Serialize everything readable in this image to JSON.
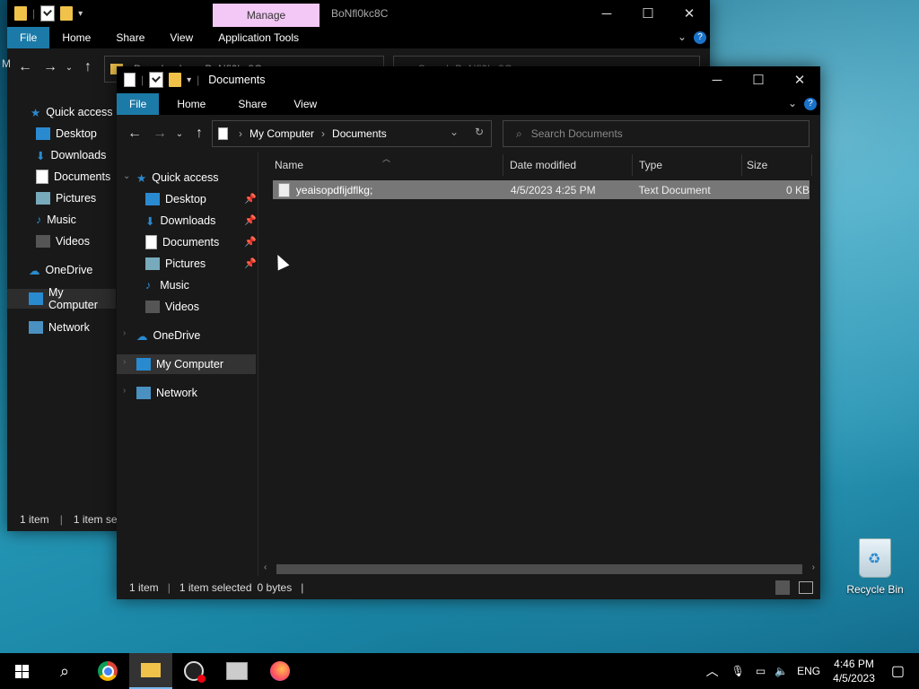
{
  "back_window": {
    "qat_sep": "|",
    "context_tab": "Manage",
    "title": "BoNfl0kc8C",
    "tabs": [
      "File",
      "Home",
      "Share",
      "View",
      "Application Tools"
    ],
    "address": {
      "part1": "Downloads",
      "part2": "BoNfl0kc8C"
    },
    "search_placeholder": "Search BoNfl0kc8C",
    "left_edge_letter": "M",
    "sidebar": [
      "Quick access",
      "Desktop",
      "Downloads",
      "Documents",
      "Pictures",
      "Music",
      "Videos",
      "OneDrive",
      "My Computer",
      "Network"
    ],
    "status": {
      "count": "1 item",
      "selected": "1 item sele"
    }
  },
  "front_window": {
    "title": "Documents",
    "tabs": [
      "File",
      "Home",
      "Share",
      "View"
    ],
    "address": {
      "part1": "My Computer",
      "part2": "Documents"
    },
    "search_placeholder": "Search Documents",
    "sidebar": {
      "quick_access": "Quick access",
      "pinned": [
        "Desktop",
        "Downloads",
        "Documents",
        "Pictures"
      ],
      "unpinned": [
        "Music",
        "Videos"
      ],
      "onedrive": "OneDrive",
      "my_computer": "My Computer",
      "network": "Network"
    },
    "columns": {
      "name": "Name",
      "date": "Date modified",
      "type": "Type",
      "size": "Size"
    },
    "files": [
      {
        "name": "yeaisopdfijdflkg;",
        "date": "4/5/2023 4:25 PM",
        "type": "Text Document",
        "size": "0 KB"
      }
    ],
    "status": {
      "count": "1 item",
      "selected": "1 item selected",
      "bytes": "0 bytes"
    }
  },
  "desktop": {
    "recycle_bin": "Recycle Bin"
  },
  "taskbar": {
    "lang": "ENG",
    "time": "4:46 PM",
    "date": "4/5/2023"
  }
}
